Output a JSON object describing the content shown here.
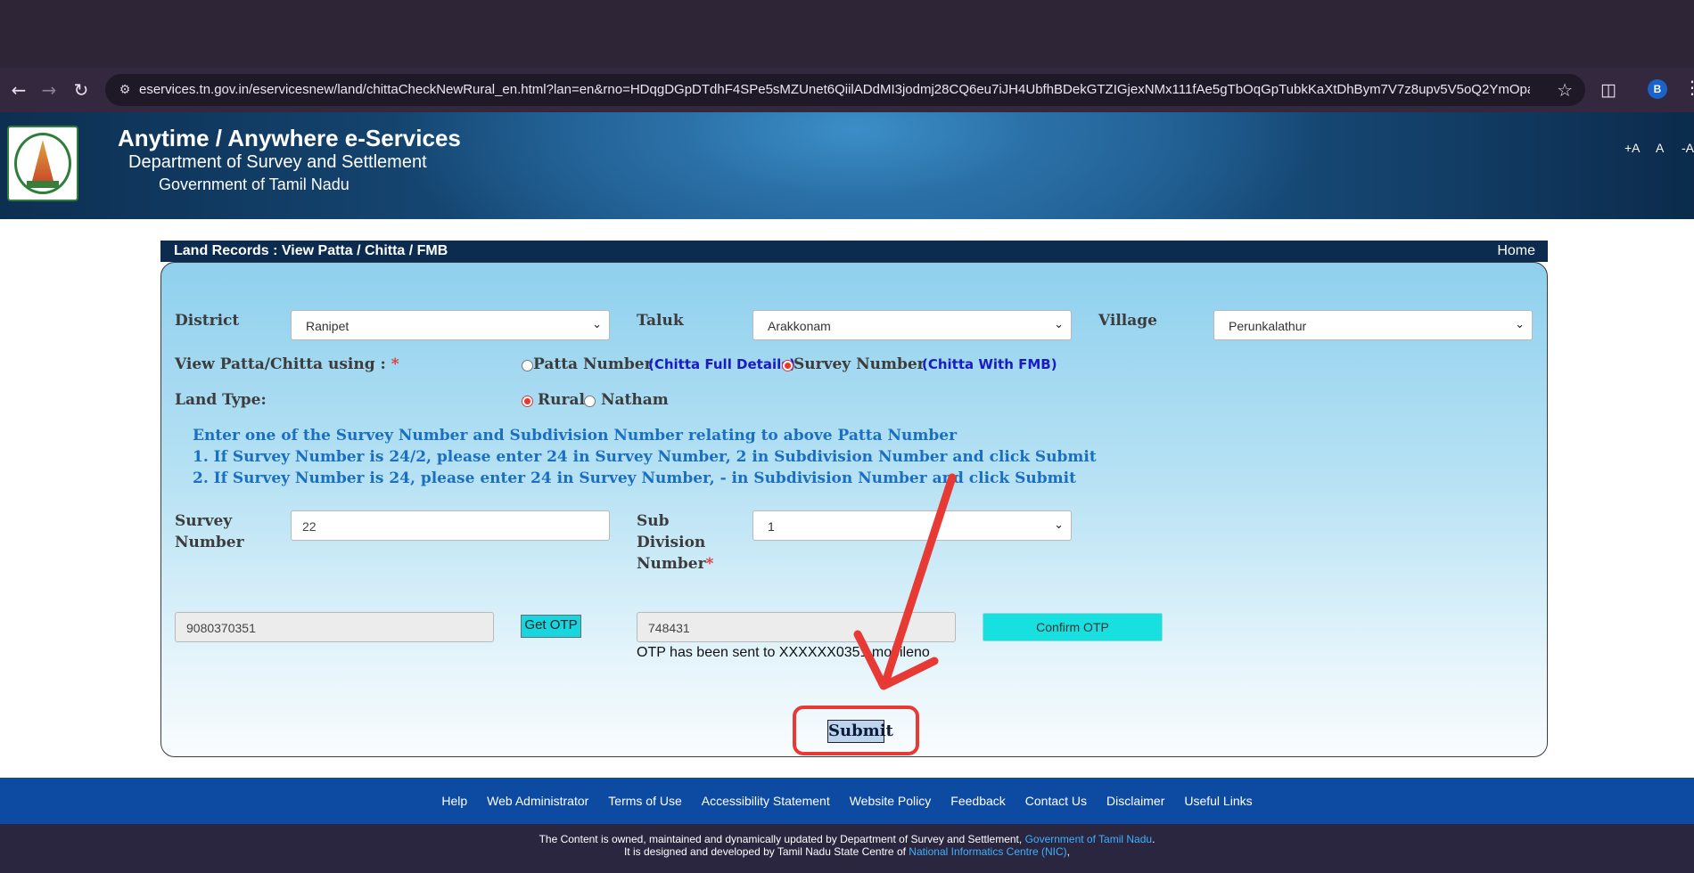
{
  "browser": {
    "url": "eservices.tn.gov.in/eservicesnew/land/chittaCheckNewRural_en.html?lan=en&rno=HDqgDGpDTdhF4SPe5sMZUnet6QiilADdMI3jodmj28CQ6eu7iJH4UbfhBDekGTZIGjexNMx111fAe5gTbOqGpTubkKaXtDhBym7V7z8upv5V5oQ2YmOpa49J4I0Ae2RMAXPXh7...",
    "profile_initial": "B",
    "icons": [
      "back-icon",
      "forward-icon",
      "reload-icon",
      "site-info-icon",
      "bookmark-star-icon",
      "extensions-icon",
      "menu-icon"
    ]
  },
  "header": {
    "title": "Anytime / Anywhere e-Services",
    "department": "Department of Survey and Settlement",
    "government": "Government of Tamil Nadu",
    "font_increase": "+A",
    "font_normal": "A",
    "font_decrease": "-A"
  },
  "breadcrumb": {
    "title": "Land Records : View Patta / Chitta / FMB",
    "home": "Home"
  },
  "form": {
    "district_label": "District",
    "district_value": "Ranipet",
    "taluk_label": "Taluk",
    "taluk_value": "Arakkonam",
    "village_label": "Village",
    "village_value": "Perunkalathur",
    "view_using_label": "View Patta/Chitta using :",
    "required_mark": "*",
    "option_patta": "Patta Number",
    "option_patta_note": "(Chitta Full Details)",
    "option_survey": "Survey Number",
    "option_survey_note": "(Chitta With FMB)",
    "selected_view_option": "Survey Number",
    "land_type_label": "Land Type:",
    "land_rural": "Rural",
    "land_natham": "Natham",
    "selected_land_type": "Rural",
    "instructions": [
      "Enter one of the Survey Number and Subdivision Number relating to above Patta Number",
      "1. If Survey Number is 24/2, please enter 24 in Survey Number, 2 in Subdivision Number and click Submit",
      "2. If Survey Number is 24, please enter 24 in Survey Number, - in Subdivision Number and click Submit"
    ],
    "survey_label_line1": "Survey",
    "survey_label_line2": "Number",
    "survey_value": "22",
    "subdivision_label_line1": "Sub",
    "subdivision_label_line2": "Division",
    "subdivision_label_line3": "Number",
    "subdivision_value": "1",
    "mobile_value": "9080370351",
    "get_otp_label": "Get OTP",
    "otp_value": "748431",
    "confirm_otp_label": "Confirm OTP",
    "otp_message": "OTP has been sent to XXXXXX0351 mobileno",
    "submit_label": "Submit"
  },
  "footer": {
    "links": [
      "Help",
      "Web Administrator",
      "Terms of Use",
      "Accessibility Statement",
      "Website Policy",
      "Feedback",
      "Contact Us",
      "Disclaimer",
      "Useful Links"
    ],
    "content_line_prefix": "The Content is owned, maintained and dynamically updated by Department of Survey and Settlement, ",
    "content_line_link": "Government of Tamil Nadu",
    "content_line_suffix": ".",
    "design_line_prefix": "It is designed and developed by Tamil Nadu State Centre of ",
    "design_line_link": "National Informatics Centre (NIC)",
    "design_line_suffix": ","
  },
  "colors": {
    "accent_cyan": "#18e0e0",
    "annotation_red": "#e73a34",
    "header_dark_blue": "#0b2c4e",
    "footer_blue": "#0d4ba3"
  }
}
